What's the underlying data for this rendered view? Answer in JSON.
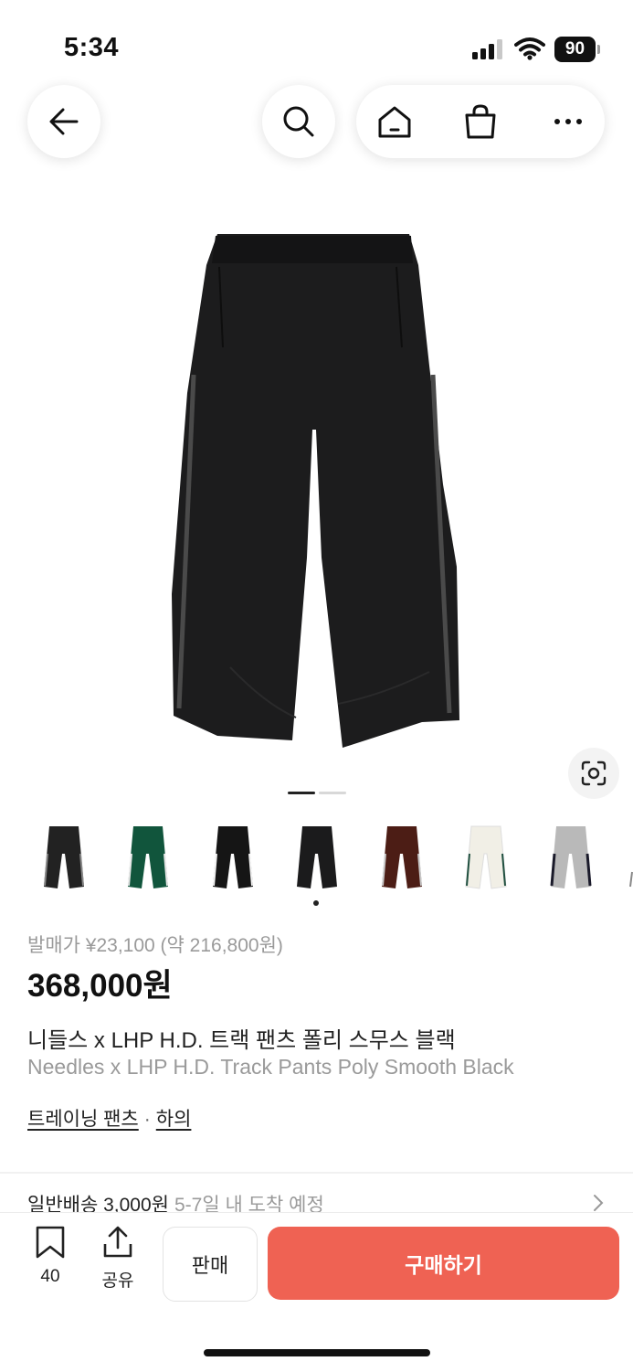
{
  "status_bar": {
    "time": "5:34",
    "battery": "90"
  },
  "header": {
    "back_icon": "arrow-left-icon",
    "search_icon": "search-icon",
    "home_icon": "home-icon",
    "bag_icon": "shopping-bag-icon",
    "more_icon": "more-dots-icon"
  },
  "gallery": {
    "current_index": 1,
    "total_pages": 2
  },
  "thumbnails": [
    {
      "color": "black-gray"
    },
    {
      "color": "green"
    },
    {
      "color": "black-white"
    },
    {
      "color": "black-black"
    },
    {
      "color": "brown"
    },
    {
      "color": "white"
    },
    {
      "color": "gray"
    }
  ],
  "product": {
    "release_price": "발매가 ¥23,100 (약 216,800원)",
    "price": "368,000원",
    "name_ko": "니들스 x LHP H.D. 트랙 팬츠 폴리 스무스 블랙",
    "name_en": "Needles x LHP H.D. Track Pants Poly Smooth Black",
    "category": "트레이닝 팬츠",
    "category_sep": "·",
    "subcategory": "하의"
  },
  "shipping": {
    "label": "일반배송 3,000원",
    "eta": "5-7일 내 도착 예정"
  },
  "bottom_bar": {
    "bookmark_count": "40",
    "share_label": "공유",
    "sell_label": "판매",
    "buy_label": "구매하기"
  },
  "colors": {
    "accent": "#ef6253",
    "muted_text": "#9a9a9a"
  }
}
